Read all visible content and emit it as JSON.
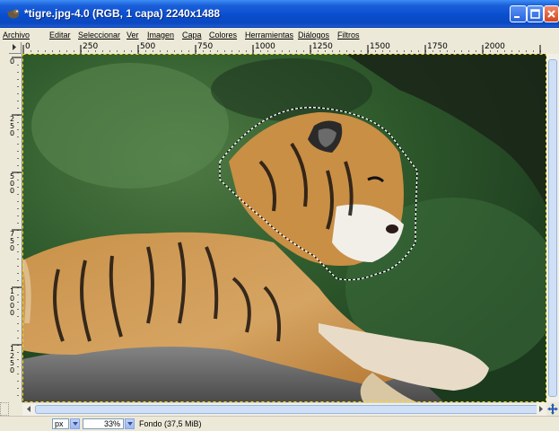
{
  "window": {
    "title": "*tigre.jpg-4.0 (RGB, 1 capa) 2240x1488"
  },
  "menu": [
    "Archivo",
    "Editar",
    "Seleccionar",
    "Ver",
    "Imagen",
    "Capa",
    "Colores",
    "Herramientas",
    "Diálogos",
    "Filtros"
  ],
  "ruler_top": [
    "0",
    "250",
    "500",
    "750",
    "1000",
    "1250",
    "1500",
    "1750",
    "2000"
  ],
  "ruler_left": [
    "0",
    "250",
    "500",
    "750",
    "1000",
    "1250"
  ],
  "status": {
    "unit": "px",
    "zoom": "33%",
    "layer_info": "Fondo (37,5 MiB)"
  },
  "colors": {
    "title_bar": "#0b48bf",
    "selection": "#ffffff",
    "background_foliage": "#2f5a2c",
    "tiger": "#c98a3c"
  }
}
